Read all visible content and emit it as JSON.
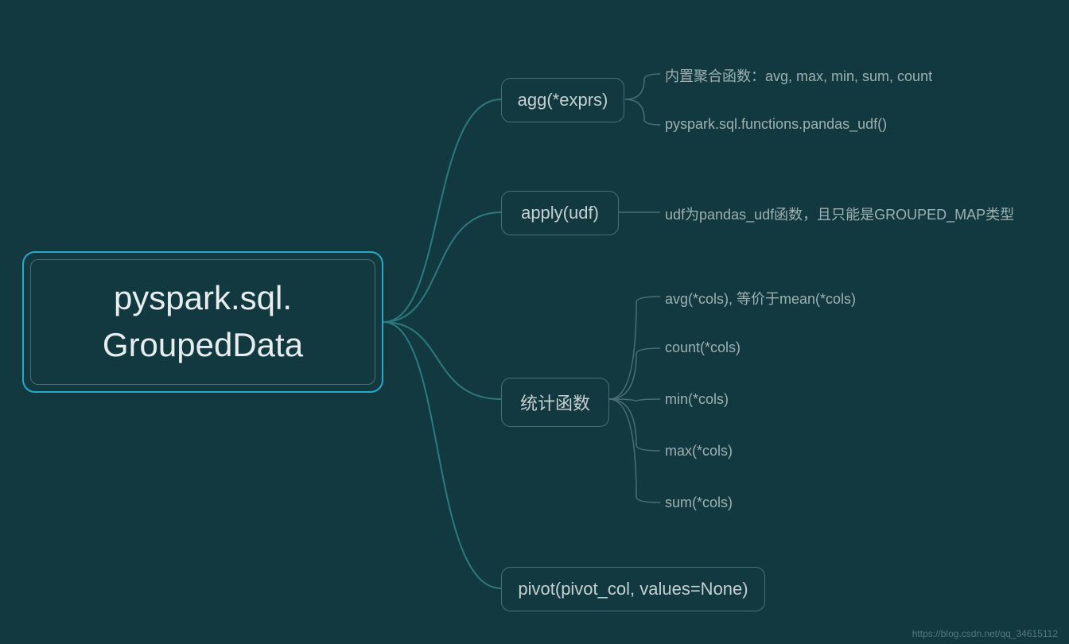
{
  "root": {
    "title": "pyspark.sql.\nGroupedData"
  },
  "children": {
    "agg": {
      "label": "agg(*exprs)",
      "leaves": [
        "内置聚合函数：avg, max, min, sum, count",
        "pyspark.sql.functions.pandas_udf()"
      ]
    },
    "apply": {
      "label": "apply(udf)",
      "leaves": [
        "udf为pandas_udf函数，且只能是GROUPED_MAP类型"
      ]
    },
    "stats": {
      "label": "统计函数",
      "leaves": [
        "avg(*cols), 等价于mean(*cols)",
        "count(*cols)",
        "min(*cols)",
        "max(*cols)",
        "sum(*cols)"
      ]
    },
    "pivot": {
      "label": "pivot(pivot_col, values=None)"
    }
  },
  "watermark": "https://blog.csdn.net/qq_34615112"
}
